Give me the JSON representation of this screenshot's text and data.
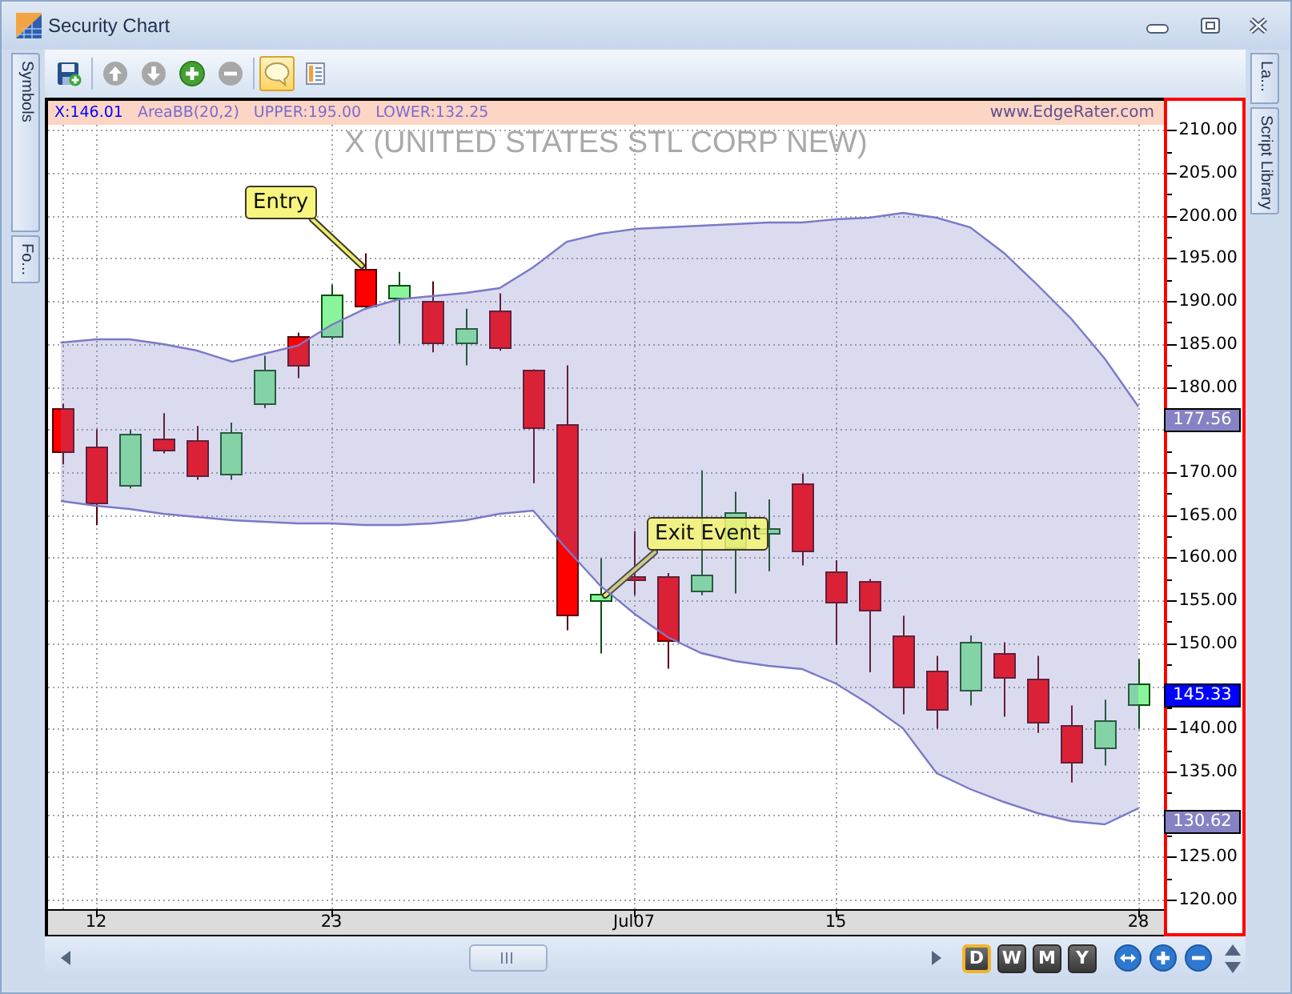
{
  "window": {
    "title": "Security Chart"
  },
  "left_tabs": [
    {
      "label": "Symbols"
    },
    {
      "label": "Fo..."
    }
  ],
  "toolbar": {
    "groups": [
      [
        {
          "kind": "save",
          "disabled": false,
          "on": false
        }
      ],
      [
        {
          "kind": "up",
          "disabled": true,
          "on": false
        },
        {
          "kind": "down",
          "disabled": true,
          "on": false
        },
        {
          "kind": "add",
          "disabled": false,
          "on": false
        },
        {
          "kind": "remove",
          "disabled": true,
          "on": false
        }
      ],
      [
        {
          "kind": "note",
          "disabled": false,
          "on": true
        },
        {
          "kind": "sheet",
          "disabled": false,
          "on": false
        }
      ]
    ]
  },
  "chart": {
    "legend": [
      {
        "text": "X:146.01",
        "color": "#0000ff"
      },
      {
        "text": "AreaBB(20,2)",
        "color": "#7a6cd4"
      },
      {
        "text": "UPPER:195.00",
        "color": "#7a6cd4"
      },
      {
        "text": "LOWER:132.25",
        "color": "#7a6cd4"
      }
    ],
    "site": "www.EdgeRater.com",
    "annotations": [
      {
        "text": "Entry"
      },
      {
        "text": "Exit Event"
      }
    ],
    "chart_data": {
      "type": "candlestick",
      "title": "X (UNITED STATES STL CORP NEW)",
      "categories": [
        null,
        "12",
        null,
        null,
        null,
        null,
        null,
        null,
        "23",
        null,
        null,
        null,
        null,
        null,
        null,
        null,
        null,
        "Jul07",
        null,
        null,
        null,
        null,
        null,
        "15",
        null,
        null,
        null,
        null,
        null,
        null,
        null,
        null,
        "28"
      ],
      "ohlc": [
        [
          177.5,
          178.0,
          170.9,
          172.4
        ],
        [
          173.0,
          175.0,
          163.8,
          166.4
        ],
        [
          168.5,
          175.0,
          168.1,
          174.5
        ],
        [
          173.9,
          176.9,
          172.2,
          172.6
        ],
        [
          173.7,
          175.4,
          169.1,
          169.6
        ],
        [
          169.8,
          175.8,
          169.1,
          174.7
        ],
        [
          178.0,
          183.6,
          177.5,
          182.0
        ],
        [
          185.9,
          186.3,
          181.0,
          182.5
        ],
        [
          185.9,
          191.9,
          185.5,
          190.8
        ],
        [
          193.8,
          195.6,
          189.1,
          189.5
        ],
        [
          190.4,
          193.4,
          185.0,
          191.9
        ],
        [
          190.0,
          192.3,
          184.0,
          185.2
        ],
        [
          185.2,
          189.1,
          182.5,
          186.8
        ],
        [
          188.9,
          190.9,
          184.2,
          184.6
        ],
        [
          182.0,
          182.0,
          168.7,
          175.2
        ],
        [
          175.6,
          182.5,
          151.5,
          153.3
        ],
        [
          155.0,
          159.9,
          148.8,
          155.8
        ],
        [
          157.8,
          163.1,
          155.6,
          157.5
        ],
        [
          157.8,
          158.2,
          147.0,
          150.3
        ],
        [
          156.1,
          170.2,
          155.6,
          158.0
        ],
        [
          161.2,
          167.7,
          155.8,
          165.3
        ],
        [
          162.9,
          166.8,
          158.4,
          163.4
        ],
        [
          168.7,
          169.8,
          159.1,
          160.8
        ],
        [
          158.4,
          159.7,
          149.8,
          154.8
        ],
        [
          157.3,
          157.5,
          146.6,
          153.9
        ],
        [
          150.9,
          153.2,
          141.7,
          144.9
        ],
        [
          146.8,
          148.5,
          140.0,
          142.3
        ],
        [
          144.5,
          150.9,
          142.7,
          150.1
        ],
        [
          148.8,
          150.1,
          141.4,
          145.9
        ],
        [
          145.9,
          148.5,
          139.5,
          140.8
        ],
        [
          140.4,
          142.7,
          133.7,
          136.1
        ],
        [
          137.8,
          143.4,
          135.7,
          141.0
        ],
        [
          142.9,
          148.1,
          140.0,
          145.3
        ]
      ],
      "ylim": [
        118.9,
        210.6
      ],
      "yticks": [
        {
          "value": 210,
          "label": "210.00"
        },
        {
          "value": 205,
          "label": "205.00"
        },
        {
          "value": 200,
          "label": "200.00"
        },
        {
          "value": 195,
          "label": "195.00"
        },
        {
          "value": 190,
          "label": "190.00"
        },
        {
          "value": 185,
          "label": "185.00"
        },
        {
          "value": 180,
          "label": "180.00"
        },
        {
          "value": 170,
          "label": "170.00"
        },
        {
          "value": 165,
          "label": "165.00"
        },
        {
          "value": 160,
          "label": "160.00"
        },
        {
          "value": 155,
          "label": "155.00"
        },
        {
          "value": 150,
          "label": "150.00"
        },
        {
          "value": 140,
          "label": "140.00"
        },
        {
          "value": 135,
          "label": "135.00"
        },
        {
          "value": 125,
          "label": "125.00"
        },
        {
          "value": 120,
          "label": "120.00"
        }
      ],
      "grid": true
    },
    "price_markers": [
      {
        "text": "177.56",
        "color": "#8682c4"
      },
      {
        "text": "145.33",
        "color": "#0000ff"
      },
      {
        "text": "130.62",
        "color": "#8682c4"
      }
    ]
  },
  "navigator": {
    "periods": [
      {
        "label": "D",
        "selected": true
      },
      {
        "label": "W",
        "selected": false
      },
      {
        "label": "M",
        "selected": false
      },
      {
        "label": "Y",
        "selected": false
      }
    ]
  },
  "right_tabs": [
    {
      "label": "La..."
    },
    {
      "label": "Script Library"
    }
  ]
}
